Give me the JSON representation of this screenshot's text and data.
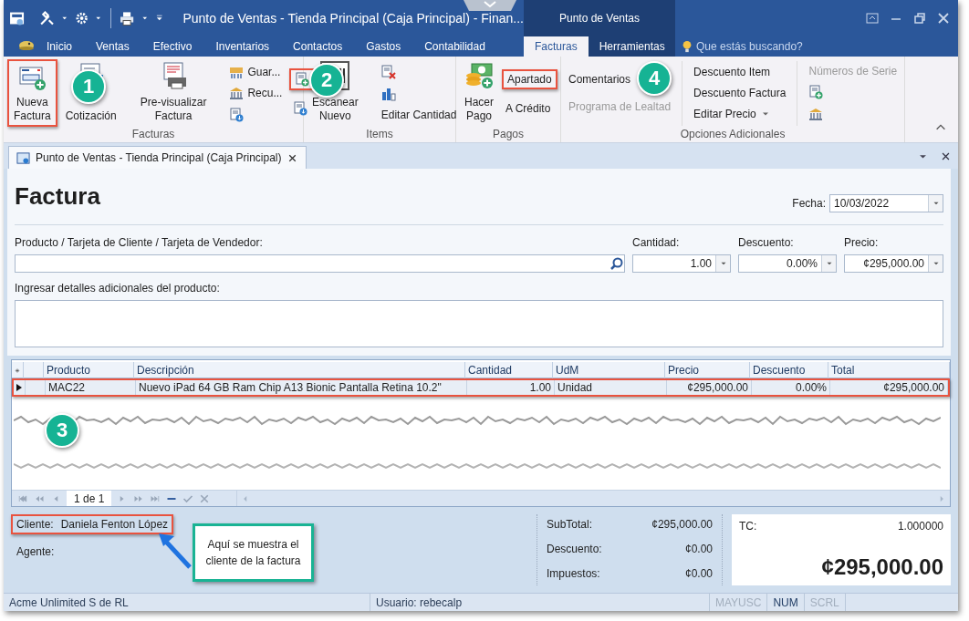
{
  "window": {
    "title": "Punto de Ventas - Tienda Principal (Caja Principal) - Finan...",
    "context_title": "Punto de Ventas"
  },
  "ribbon_tabs": [
    {
      "label": "Inicio",
      "selected": false,
      "context": false
    },
    {
      "label": "Ventas",
      "selected": false,
      "context": false
    },
    {
      "label": "Efectivo",
      "selected": false,
      "context": false
    },
    {
      "label": "Inventarios",
      "selected": false,
      "context": false
    },
    {
      "label": "Contactos",
      "selected": false,
      "context": false
    },
    {
      "label": "Gastos",
      "selected": false,
      "context": false
    },
    {
      "label": "Contabilidad",
      "selected": false,
      "context": false
    },
    {
      "label": "Facturas",
      "selected": true,
      "context": true
    },
    {
      "label": "Herramientas",
      "selected": false,
      "context": true
    }
  ],
  "search": {
    "placeholder": "Que estás buscando?"
  },
  "ribbon_groups": [
    {
      "label": "Facturas",
      "items": [
        {
          "kind": "large",
          "lines": [
            "Nueva",
            "Factura"
          ],
          "highlighted": true
        },
        {
          "kind": "large",
          "lines": [
            "Cotización"
          ],
          "highlighted": false
        },
        {
          "kind": "separator"
        },
        {
          "kind": "large",
          "lines": [
            "Pre-visualizar",
            "Factura"
          ],
          "highlighted": false
        },
        {
          "kind": "separator"
        },
        {
          "kind": "stack",
          "entries": [
            {
              "kind": "small",
              "label": "Guar...",
              "disabled": false,
              "highlighted": false
            },
            {
              "kind": "small",
              "label": "Recu...",
              "disabled": false,
              "highlighted": false
            },
            {
              "kind": "icon",
              "disabled": false,
              "highlighted": false
            }
          ]
        },
        {
          "kind": "stack",
          "entries": [
            {
              "kind": "icon",
              "disabled": false,
              "highlighted": true
            },
            {
              "kind": "icon",
              "disabled": false,
              "highlighted": false
            }
          ]
        }
      ]
    },
    {
      "label": "Items",
      "items": [
        {
          "kind": "large",
          "lines": [
            "Escanear",
            "Nuevo"
          ],
          "highlighted": false
        },
        {
          "kind": "separator"
        },
        {
          "kind": "stack",
          "entries": [
            {
              "kind": "icon",
              "disabled": false,
              "highlighted": false
            },
            {
              "kind": "icon",
              "disabled": false,
              "highlighted": false
            },
            {
              "kind": "text",
              "label": "Editar Cantidad",
              "disabled": false,
              "highlighted": false
            }
          ]
        }
      ]
    },
    {
      "label": "Pagos",
      "items": [
        {
          "kind": "large",
          "lines": [
            "Hacer",
            "Pago"
          ],
          "highlighted": false
        },
        {
          "kind": "stack",
          "entries": [
            {
              "kind": "text",
              "label": "Apartado",
              "disabled": false,
              "highlighted": true
            },
            {
              "kind": "text",
              "label": "A Crédito",
              "disabled": false,
              "highlighted": false
            }
          ]
        }
      ]
    },
    {
      "label": "Opciones Adicionales",
      "items": [
        {
          "kind": "stack",
          "entries": [
            {
              "kind": "text",
              "label": "Comentarios",
              "disabled": false,
              "highlighted": false
            },
            {
              "kind": "text",
              "label": "Programa de Lealtad",
              "disabled": true,
              "highlighted": false
            }
          ]
        },
        {
          "kind": "separator"
        },
        {
          "kind": "stack",
          "entries": [
            {
              "kind": "text",
              "label": "Descuento Item",
              "disabled": false,
              "highlighted": false
            },
            {
              "kind": "text",
              "label": "Descuento Factura",
              "disabled": false,
              "highlighted": false
            },
            {
              "kind": "dropdown",
              "label": "Editar Precio",
              "disabled": false,
              "highlighted": false
            }
          ]
        },
        {
          "kind": "separator"
        },
        {
          "kind": "stack",
          "entries": [
            {
              "kind": "text",
              "label": "Números de Serie",
              "disabled": true,
              "highlighted": false
            },
            {
              "kind": "icon",
              "disabled": false,
              "highlighted": false
            },
            {
              "kind": "icon",
              "disabled": false,
              "highlighted": false
            }
          ]
        }
      ]
    }
  ],
  "doc_tab": {
    "label": "Punto de Ventas - Tienda Principal (Caja Principal)"
  },
  "form": {
    "title": "Factura",
    "date": {
      "label": "Fecha:",
      "value": "10/03/2022"
    },
    "product": {
      "label": "Producto / Tarjeta de Cliente / Tarjeta de Vendedor:"
    },
    "fields": [
      {
        "label": "Cantidad:",
        "value": "1.00"
      },
      {
        "label": "Descuento:",
        "value": "0.00%"
      },
      {
        "label": "Precio:",
        "value": "¢295,000.00"
      }
    ],
    "details": {
      "label": "Ingresar detalles adicionales del producto:"
    }
  },
  "grid": {
    "columns": [
      "Producto",
      "Descripción",
      "Cantidad",
      "UdM",
      "Precio",
      "Descuento",
      "Total"
    ],
    "rows": [
      {
        "selected": true,
        "highlighted": true,
        "cells": [
          "MAC22",
          "Nuevo iPad 64 GB Ram Chip A13 Bionic Pantalla Retina 10.2\"",
          "1.00",
          "Unidad",
          "¢295,000.00",
          "0.00%",
          "¢295,000.00"
        ]
      }
    ],
    "navigator": {
      "position": "1 de 1"
    }
  },
  "customer": {
    "label": "Cliente:",
    "value": "Daniela Fenton López",
    "highlighted": true
  },
  "agent": {
    "label": "Agente:"
  },
  "totals": [
    {
      "label": "SubTotal:",
      "value": "¢295,000.00"
    },
    {
      "label": "Descuento:",
      "value": "¢0.00"
    },
    {
      "label": "Impuestos:",
      "value": "¢0.00"
    }
  ],
  "exchange": {
    "label": "TC:",
    "value": "1.000000"
  },
  "grand_total": "¢295,000.00",
  "status_bar": {
    "company": "Acme Unlimited S de RL",
    "user": "Usuario: rebecalp",
    "indicators": [
      {
        "label": "MAYUSC",
        "on": false
      },
      {
        "label": "NUM",
        "on": true
      },
      {
        "label": "SCRL",
        "on": false
      }
    ]
  },
  "annotations": {
    "badges": [
      "1",
      "2",
      "3",
      "4"
    ],
    "callout": "Aquí se muestra el cliente de la factura"
  }
}
